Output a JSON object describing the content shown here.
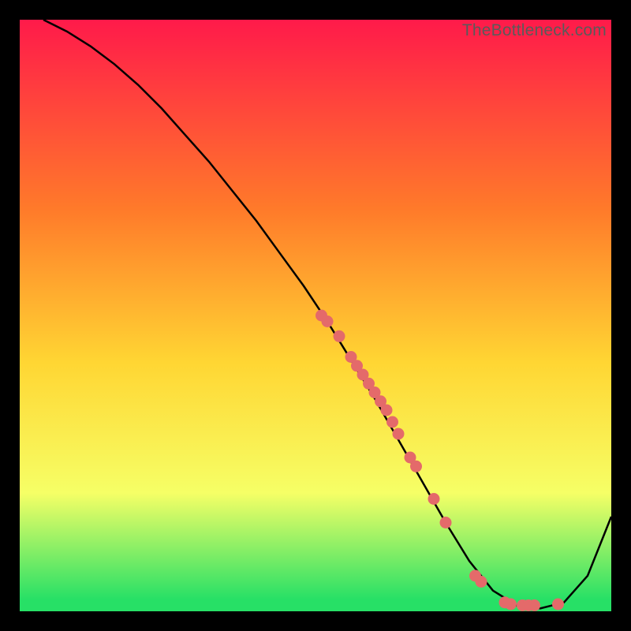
{
  "watermark": "TheBottleneck.com",
  "colors": {
    "frame_bg": "#000000",
    "gradient_top": "#ff1a4a",
    "gradient_mid1": "#ff7a2a",
    "gradient_mid2": "#ffd633",
    "gradient_mid3": "#f6ff66",
    "gradient_bottom": "#27e066",
    "curve": "#000000",
    "dot_fill": "#e46a6a",
    "dot_stroke": "#b24a4a"
  },
  "chart_data": {
    "type": "line",
    "title": "",
    "xlabel": "",
    "ylabel": "",
    "xlim": [
      0,
      100
    ],
    "ylim": [
      0,
      100
    ],
    "curve": {
      "x": [
        4,
        8,
        12,
        16,
        20,
        24,
        28,
        32,
        36,
        40,
        44,
        48,
        52,
        56,
        60,
        64,
        68,
        72,
        76,
        80,
        84,
        88,
        92,
        96,
        100
      ],
      "y": [
        100,
        98,
        95.5,
        92.5,
        89,
        85,
        80.5,
        76,
        71,
        66,
        60.5,
        55,
        49,
        42.5,
        36,
        29,
        22,
        15,
        8.5,
        3.5,
        1,
        0.5,
        1.5,
        6,
        16
      ]
    },
    "series": [
      {
        "name": "markers",
        "x": [
          51,
          52,
          54,
          56,
          57,
          58,
          59,
          60,
          61,
          62,
          63,
          64,
          66,
          67,
          70,
          72,
          77,
          78,
          82,
          83,
          85,
          86,
          87,
          91
        ],
        "y": [
          50,
          49,
          46.5,
          43,
          41.5,
          40,
          38.5,
          37,
          35.5,
          34,
          32,
          30,
          26,
          24.5,
          19,
          15,
          6,
          5,
          1.5,
          1.2,
          1,
          1,
          1,
          1.2
        ]
      }
    ]
  }
}
